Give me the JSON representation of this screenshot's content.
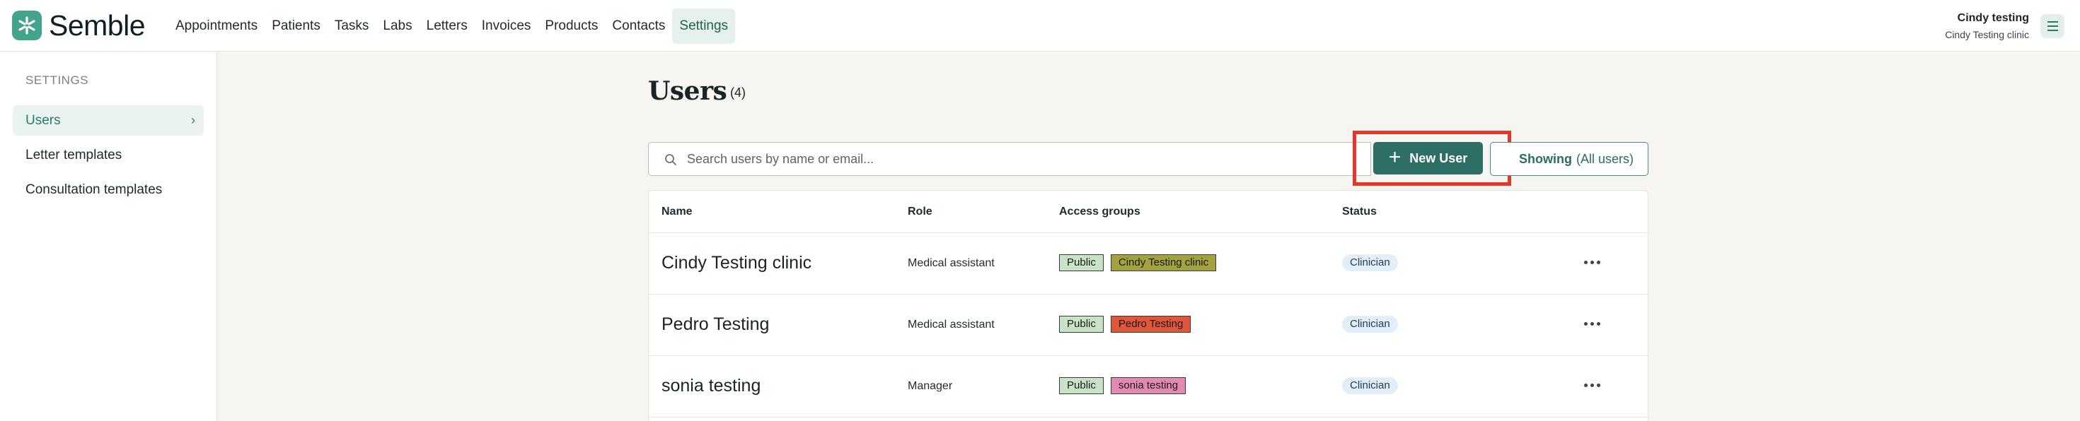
{
  "app": {
    "name": "Semble"
  },
  "nav": {
    "items": [
      {
        "label": "Appointments"
      },
      {
        "label": "Patients"
      },
      {
        "label": "Tasks"
      },
      {
        "label": "Labs"
      },
      {
        "label": "Letters"
      },
      {
        "label": "Invoices"
      },
      {
        "label": "Products"
      },
      {
        "label": "Contacts"
      },
      {
        "label": "Settings",
        "active": true
      }
    ]
  },
  "user": {
    "name": "Cindy testing",
    "clinic": "Cindy Testing clinic"
  },
  "sidebar": {
    "heading": "SETTINGS",
    "items": [
      {
        "label": "Users",
        "active": true
      },
      {
        "label": "Letter templates"
      },
      {
        "label": "Consultation templates"
      }
    ]
  },
  "page": {
    "title": "Users",
    "count": "(4)"
  },
  "search": {
    "placeholder": "Search users by name or email..."
  },
  "toolbar": {
    "new_user_label": "New User",
    "showing_label": "Showing",
    "showing_value": "(All users)"
  },
  "table": {
    "columns": [
      "Name",
      "Role",
      "Access groups",
      "Status"
    ],
    "rows": [
      {
        "name": "Cindy Testing clinic",
        "role": "Medical assistant",
        "groups": [
          {
            "label": "Public",
            "color": "#c9e3c6"
          },
          {
            "label": "Cindy Testing clinic",
            "color": "#a4a23f"
          }
        ],
        "status": "Clinician"
      },
      {
        "name": "Pedro Testing",
        "role": "Medical assistant",
        "groups": [
          {
            "label": "Public",
            "color": "#c9e3c6"
          },
          {
            "label": "Pedro Testing",
            "color": "#e0563a"
          }
        ],
        "status": "Clinician"
      },
      {
        "name": "sonia testing",
        "role": "Manager",
        "groups": [
          {
            "label": "Public",
            "color": "#c9e3c6"
          },
          {
            "label": "sonia testing",
            "color": "#e38ab2"
          }
        ],
        "status": "Clinician"
      }
    ]
  },
  "colors": {
    "brand": "#43a38c",
    "primary_button": "#2e6f65",
    "highlight": "#e03a2c"
  }
}
